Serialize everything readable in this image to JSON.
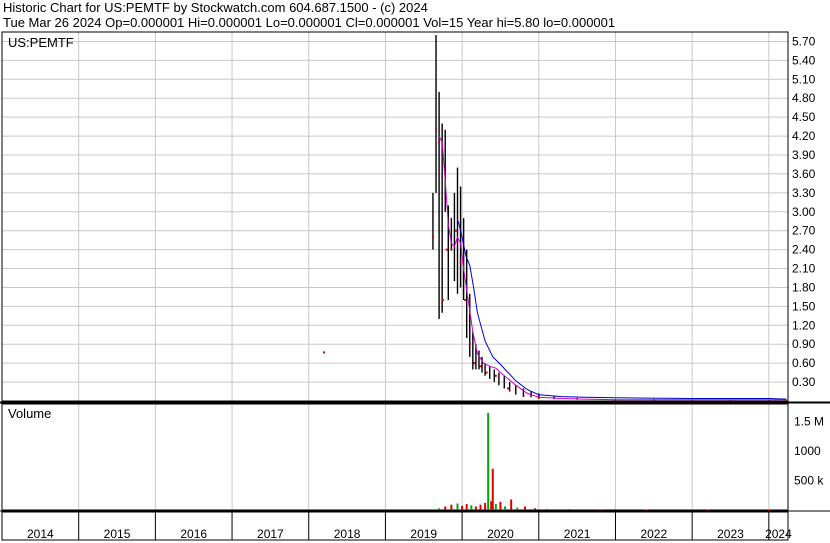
{
  "header": {
    "line1": "Historic Chart for US:PEMTF by Stockwatch.com 604.687.1500 - (c) 2024",
    "line2": "Tue Mar 26 2024  Op=0.000001  Hi=0.000001  Lo=0.000001  Cl=0.000001  Vol=15  Year hi=5.80  lo=0.000001"
  },
  "colors": {
    "price_bar": "#000000",
    "close_dot": "#cc0000",
    "ma_short": "#cc00cc",
    "ma_long": "#0000cc",
    "volume_up": "#00aa00",
    "volume_down": "#dd0000",
    "grid": "#c8c8c8"
  },
  "chart_data": [
    {
      "type": "line",
      "name": "price",
      "title": "US:PEMTF",
      "y_ticks": [
        "5.70",
        "5.40",
        "5.10",
        "4.80",
        "4.50",
        "4.20",
        "3.90",
        "3.60",
        "3.30",
        "3.00",
        "2.70",
        "2.40",
        "2.10",
        "1.80",
        "1.50",
        "1.20",
        "0.90",
        "0.60",
        "0.30"
      ],
      "ylim": [
        0,
        5.85
      ],
      "x_ticks": [
        "2014",
        "2015",
        "2016",
        "2017",
        "2018",
        "2019",
        "2020",
        "2021",
        "2022",
        "2023",
        "2024"
      ],
      "xlim": [
        2014.0,
        2024.25
      ],
      "grid": true,
      "series": [
        {
          "style": "high-low bars",
          "x": [
            2019.62,
            2019.66,
            2019.7,
            2019.74,
            2019.78,
            2019.82,
            2019.86,
            2019.9,
            2019.94,
            2019.98,
            2020.02,
            2020.06,
            2020.1,
            2020.14,
            2020.18,
            2020.22,
            2020.26,
            2020.3,
            2020.36,
            2020.42,
            2020.48,
            2020.55,
            2020.62,
            2020.7,
            2020.8,
            2020.9,
            2021.0,
            2021.2,
            2021.5,
            2022.0,
            2022.5,
            2023.0,
            2023.5,
            2024.0,
            2024.23
          ],
          "low": [
            2.4,
            3.3,
            1.3,
            1.4,
            3.0,
            1.6,
            2.4,
            1.9,
            1.7,
            1.8,
            1.6,
            1.0,
            0.7,
            0.5,
            0.5,
            0.5,
            0.45,
            0.4,
            0.35,
            0.3,
            0.25,
            0.2,
            0.15,
            0.1,
            0.08,
            0.06,
            0.05,
            0.03,
            0.02,
            0.01,
            0.01,
            0.01,
            0.01,
            0.01,
            0.0
          ],
          "high": [
            3.3,
            5.8,
            4.9,
            4.4,
            4.3,
            3.1,
            2.9,
            3.3,
            3.7,
            3.4,
            2.9,
            2.4,
            1.7,
            1.1,
            0.9,
            0.8,
            0.7,
            0.6,
            0.55,
            0.5,
            0.45,
            0.4,
            0.3,
            0.25,
            0.2,
            0.15,
            0.12,
            0.08,
            0.05,
            0.03,
            0.03,
            0.02,
            0.02,
            0.02,
            0.01
          ]
        },
        {
          "style": "close dots",
          "x": [
            2018.2,
            2019.62,
            2019.66,
            2019.7,
            2019.75,
            2019.8,
            2019.86,
            2019.92,
            2019.98,
            2020.04,
            2020.1,
            2020.16,
            2020.24,
            2020.32,
            2020.44,
            2020.6,
            2020.8,
            2021.0
          ],
          "y": [
            0.77,
            2.6,
            4.3,
            4.1,
            1.6,
            2.4,
            2.4,
            2.7,
            2.2,
            1.6,
            0.9,
            0.6,
            0.55,
            0.45,
            0.4,
            0.2,
            0.08,
            0.05
          ]
        },
        {
          "style": "moving average short",
          "x": [
            2019.7,
            2019.74,
            2019.78,
            2019.82,
            2019.86,
            2019.9,
            2019.94,
            2019.98,
            2020.02,
            2020.08,
            2020.14,
            2020.2,
            2020.28,
            2020.36,
            2020.44,
            2020.55,
            2020.7,
            2020.85,
            2021.0,
            2021.3,
            2021.6,
            2022.0,
            2023.0,
            2024.0,
            2024.23
          ],
          "y": [
            4.2,
            4.1,
            3.5,
            2.8,
            2.5,
            2.45,
            2.6,
            2.5,
            2.1,
            1.6,
            1.1,
            0.75,
            0.6,
            0.55,
            0.52,
            0.4,
            0.25,
            0.12,
            0.06,
            0.04,
            0.03,
            0.02,
            0.02,
            0.02,
            0.02
          ]
        },
        {
          "style": "moving average long",
          "x": [
            2019.95,
            2020.0,
            2020.05,
            2020.1,
            2020.15,
            2020.2,
            2020.3,
            2020.4,
            2020.5,
            2020.6,
            2020.7,
            2020.85,
            2021.0,
            2021.3,
            2021.6,
            2022.0,
            2023.0,
            2024.0,
            2024.23
          ],
          "y": [
            2.85,
            2.6,
            2.3,
            2.15,
            1.8,
            1.4,
            0.95,
            0.7,
            0.58,
            0.45,
            0.32,
            0.18,
            0.1,
            0.07,
            0.06,
            0.05,
            0.04,
            0.04,
            0.03
          ]
        }
      ]
    },
    {
      "type": "bar",
      "name": "volume",
      "title": "Volume",
      "y_ticks": [
        "1.5 M",
        "1000",
        "500 k"
      ],
      "ylim": [
        0,
        1800000
      ],
      "x": [
        2019.7,
        2019.78,
        2019.86,
        2019.94,
        2020.0,
        2020.06,
        2020.12,
        2020.18,
        2020.24,
        2020.3,
        2020.34,
        2020.38,
        2020.4,
        2020.44,
        2020.5,
        2020.56,
        2020.64,
        2020.72,
        2020.82,
        2020.95,
        2021.1,
        2021.4,
        2021.8,
        2022.4,
        2023.2,
        2024.0
      ],
      "values": [
        30000,
        60000,
        90000,
        110000,
        70000,
        100000,
        80000,
        60000,
        90000,
        120000,
        1650000,
        150000,
        700000,
        100000,
        140000,
        60000,
        180000,
        40000,
        60000,
        30000,
        20000,
        15000,
        10000,
        8000,
        6000,
        3000
      ],
      "direction": [
        "up",
        "down",
        "down",
        "up",
        "down",
        "down",
        "up",
        "down",
        "down",
        "down",
        "up",
        "down",
        "down",
        "up",
        "down",
        "up",
        "down",
        "up",
        "down",
        "down",
        "up",
        "down",
        "down",
        "down",
        "down",
        "down"
      ]
    }
  ]
}
